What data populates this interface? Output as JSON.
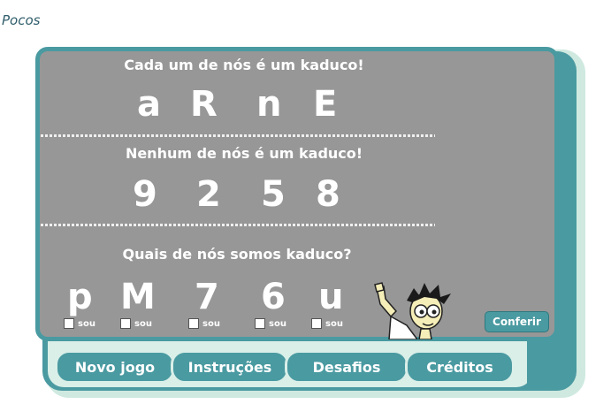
{
  "page": {
    "title": "Pocos"
  },
  "game": {
    "heading_yes": "Cada um de nós é um kaduco!",
    "examples_yes": [
      "a",
      "R",
      "n",
      "E"
    ],
    "heading_no": "Nenhum de nós é um kaduco!",
    "examples_no": [
      "9",
      "2",
      "5",
      "8"
    ],
    "question": "Quais de nós somos kaduco?",
    "choices": [
      {
        "symbol": "p",
        "label": "sou",
        "checked": false
      },
      {
        "symbol": "M",
        "label": "sou",
        "checked": false
      },
      {
        "symbol": "7",
        "label": "sou",
        "checked": false
      },
      {
        "symbol": "6",
        "label": "sou",
        "checked": false
      },
      {
        "symbol": "u",
        "label": "sou",
        "checked": false
      }
    ],
    "check_button": "Conferir"
  },
  "nav": {
    "tabs": [
      "Novo jogo",
      "Instruções",
      "Desafios",
      "Créditos"
    ]
  },
  "colors": {
    "teal": "#4a9aa1",
    "board_gray": "#979797",
    "frame_light": "#cfe9e0",
    "text_white": "#ffffff",
    "title_color": "#2f5d6b"
  }
}
